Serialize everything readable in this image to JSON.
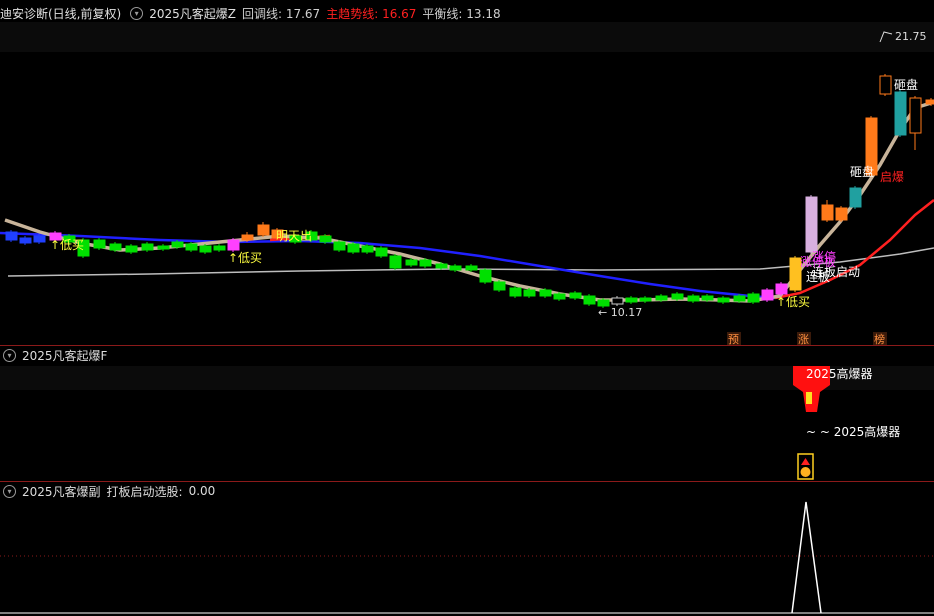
{
  "main_pane": {
    "title": "迪安诊断(日线,前复权)",
    "indicator": "2025凡客起爆Z",
    "items": [
      {
        "label": "回调线:",
        "value": "17.67",
        "color": "#cfcfcf"
      },
      {
        "label": "主趋势线:",
        "value": "16.67",
        "color": "#ff2020"
      },
      {
        "label": "平衡线:",
        "value": "13.18",
        "color": "#cfcfcf"
      }
    ],
    "price_high": "21.75",
    "price_low": "10.17",
    "markers": [
      "预",
      "涨",
      "榜"
    ],
    "signals": [
      "↑低买",
      "↑低买",
      "明天出",
      "↑低买",
      "涨停",
      "砸盘",
      "砸盘",
      "启爆",
      "连板启动",
      "连板",
      "涨停板"
    ]
  },
  "sub_pane1": {
    "title": "2025凡客起爆F",
    "labels": [
      "2025高爆器",
      "~ ~ 2025高爆器"
    ]
  },
  "sub_pane2": {
    "title": "2025凡客爆副",
    "label": "打板启动选股:",
    "value": "0.00"
  },
  "colors": {
    "up": "#ff7a1a",
    "down": "#00e000",
    "bg": "#000000",
    "separator": "#8b1a1a",
    "trend_blue": "#2020ff",
    "trend_red": "#ff2020",
    "pullback": "#c8b49a",
    "balance": "#bdbdbd"
  },
  "chart_data": {
    "type": "candlestick",
    "series": [
      {
        "name": "回调线",
        "color": "#c8b49a"
      },
      {
        "name": "主趋势线",
        "color": "#ff2020"
      },
      {
        "name": "平衡线",
        "color": "#bdbdbd"
      }
    ]
  }
}
